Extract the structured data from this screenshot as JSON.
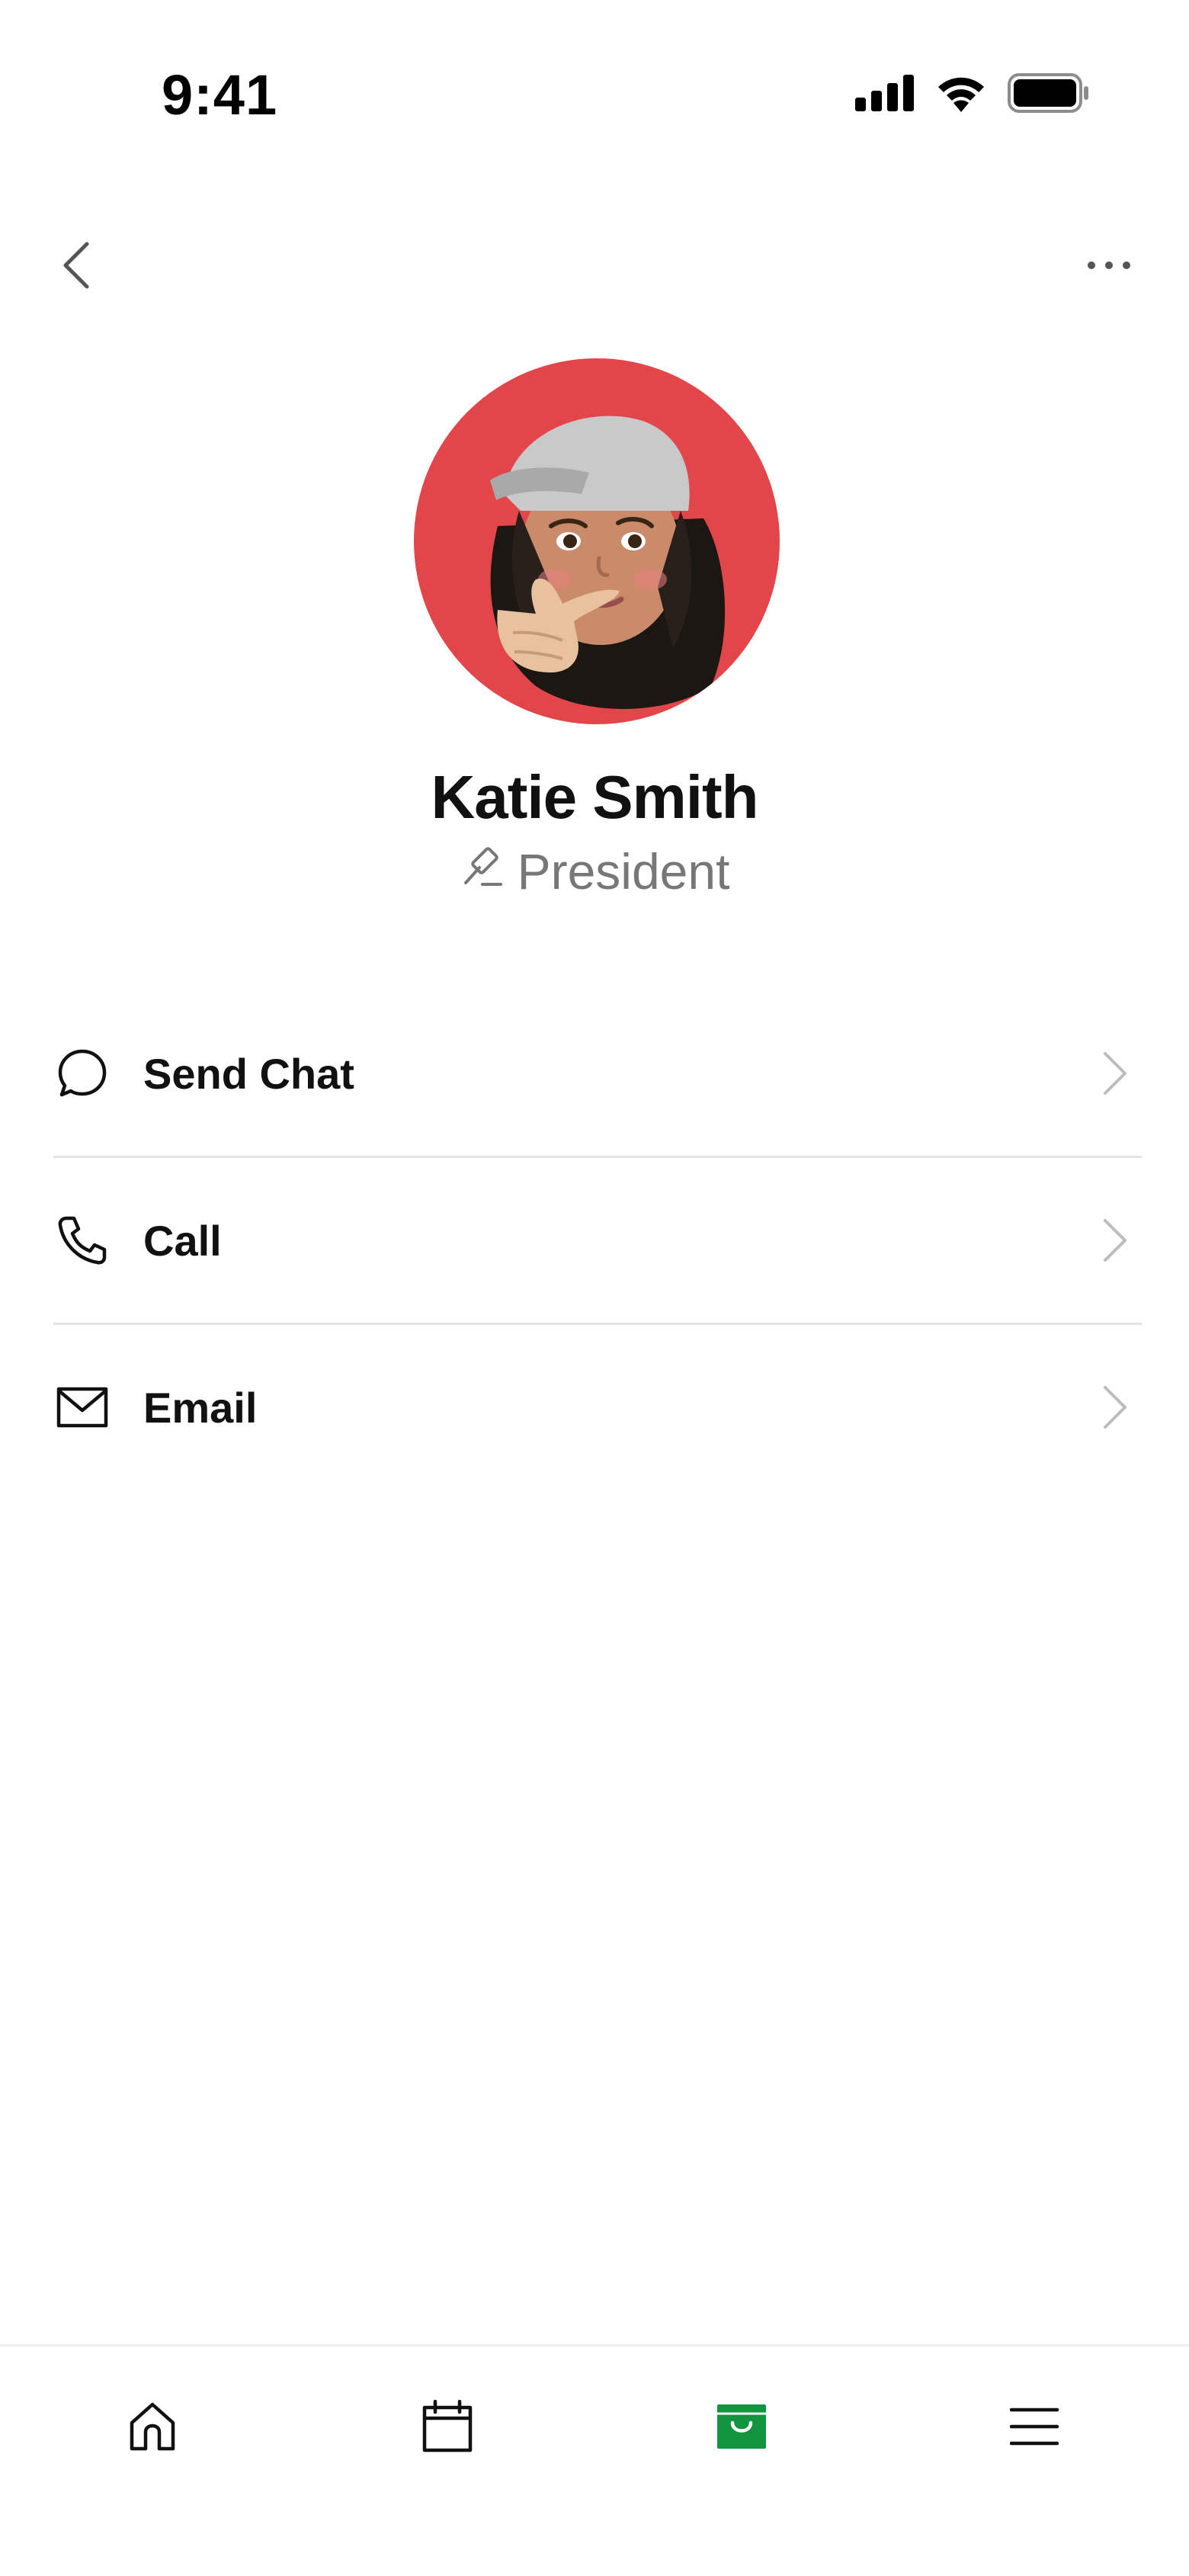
{
  "status_bar": {
    "time": "9:41",
    "icons": [
      "cellular-signal-icon",
      "wifi-icon",
      "battery-icon"
    ]
  },
  "nav": {
    "back_icon": "chevron-left-icon",
    "more_icon": "more-horizontal-icon"
  },
  "profile": {
    "avatar_background": "#e2464a",
    "name": "Katie Smith",
    "role_icon": "gavel-icon",
    "role": "President"
  },
  "actions": [
    {
      "icon": "chat-bubble-icon",
      "label": "Send Chat"
    },
    {
      "icon": "phone-icon",
      "label": "Call"
    },
    {
      "icon": "mail-icon",
      "label": "Email"
    }
  ],
  "tab_bar": {
    "items": [
      {
        "icon": "home-icon",
        "active": false
      },
      {
        "icon": "calendar-icon",
        "active": false
      },
      {
        "icon": "shopping-bag-icon",
        "active": true
      },
      {
        "icon": "menu-icon",
        "active": false
      }
    ],
    "active_color": "#12943f"
  },
  "colors": {
    "text_primary": "#111111",
    "text_secondary": "#777777",
    "divider": "#e4e4e4",
    "chevron": "#bdbdbd"
  }
}
